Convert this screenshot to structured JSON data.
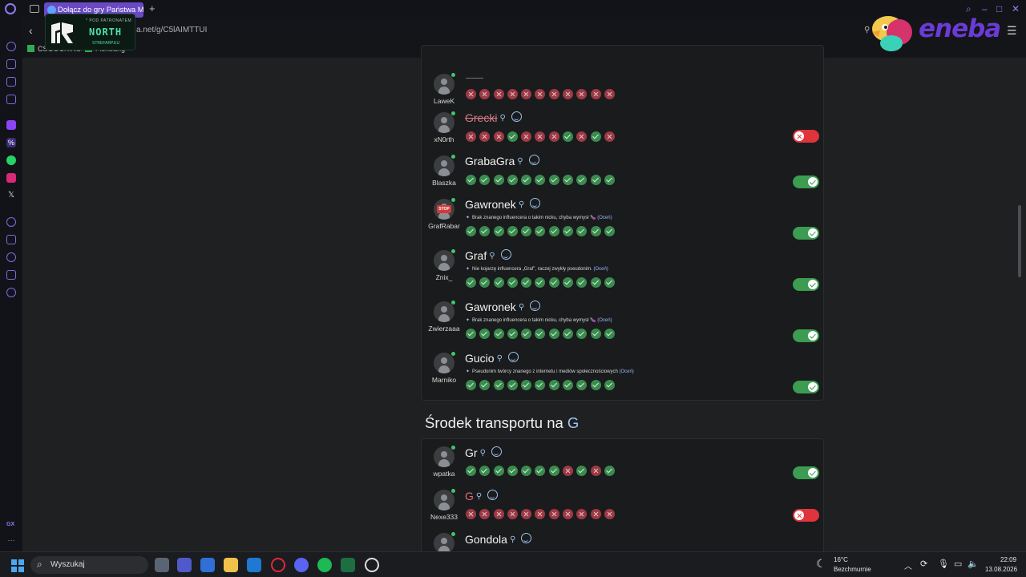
{
  "browser": {
    "tab_title": "Dołącz do gry Państwa Mia",
    "url": "a.net/g/C5lAIMTTUI",
    "bookmarks": [
      "CSGOCKINS",
      "Fishbang"
    ]
  },
  "overlay": {
    "north_top": "* POD PATRONATEM",
    "north_name": "NORTH",
    "north_sub": "STREFARP.EU",
    "eneba": "eneba"
  },
  "colors": {
    "accent": "#6a49c4",
    "ok": "#3b8b4f",
    "no": "#9c3a46",
    "toggle_on": "#3c9c52",
    "toggle_off": "#e0343c"
  },
  "category1": {
    "rows": [
      {
        "user": "LaweK",
        "answer": "",
        "dash": true,
        "votes": [
          0,
          0,
          0,
          0,
          0,
          0,
          0,
          0,
          0,
          0,
          0
        ],
        "toggle": null
      },
      {
        "user": "xN0rth",
        "answer": "Grecki",
        "strike": true,
        "votes": [
          0,
          0,
          0,
          1,
          0,
          0,
          0,
          1,
          0,
          1,
          0
        ],
        "toggle": "off"
      },
      {
        "user": "Blaszka",
        "answer": "GrabaGra",
        "votes": [
          1,
          1,
          1,
          1,
          1,
          1,
          1,
          1,
          1,
          1,
          1
        ],
        "toggle": "on"
      },
      {
        "user": "GrafRabar",
        "answer": "Gawronek",
        "note": "Brak znanego influencera o takim nicku, chyba wymysł",
        "note_emoji": "🍆",
        "rate": "(Oceń)",
        "votes": [
          1,
          1,
          1,
          1,
          1,
          1,
          1,
          1,
          1,
          1,
          1
        ],
        "toggle": "on",
        "avatar": "stop"
      },
      {
        "user": "Znix_",
        "answer": "Graf",
        "note": "Nie kojarzę influencera „Graf”, raczej zwykły pseudonim.",
        "rate": "(Oceń)",
        "votes": [
          1,
          1,
          1,
          1,
          1,
          1,
          1,
          1,
          1,
          1,
          1
        ],
        "toggle": "on"
      },
      {
        "user": "Zwierzaaa",
        "answer": "Gawronek",
        "note": "Brak znanego influencera o takim nicku, chyba wymysł",
        "note_emoji": "🍆",
        "rate": "(Oceń)",
        "votes": [
          1,
          1,
          1,
          1,
          1,
          1,
          1,
          1,
          1,
          1,
          1
        ],
        "toggle": "on"
      },
      {
        "user": "Marniko",
        "answer": "Gucio",
        "note": "Pseudonim twórcy znanego z internetu i mediów społecznościowych",
        "rate": "(Oceń)",
        "votes": [
          1,
          1,
          1,
          1,
          1,
          1,
          1,
          1,
          1,
          1,
          1
        ],
        "toggle": "on"
      }
    ]
  },
  "category2": {
    "title": "Środek transportu na",
    "letter": "G",
    "rows": [
      {
        "user": "wpatka",
        "answer": "Gr",
        "votes": [
          1,
          1,
          1,
          1,
          1,
          1,
          1,
          0,
          1,
          0,
          1
        ],
        "toggle": "on"
      },
      {
        "user": "Nexe333",
        "answer": "G",
        "bad": true,
        "votes": [
          0,
          0,
          0,
          0,
          0,
          0,
          0,
          0,
          0,
          0,
          0
        ],
        "toggle": "off"
      },
      {
        "user": "",
        "answer": "Gondola",
        "votes": [],
        "toggle": null
      }
    ]
  },
  "taskbar": {
    "search": "Wyszukaj",
    "weather_temp": "16°C",
    "weather_desc": "Bezchmurnie",
    "time": "22:09",
    "date": "13.08.2026"
  }
}
